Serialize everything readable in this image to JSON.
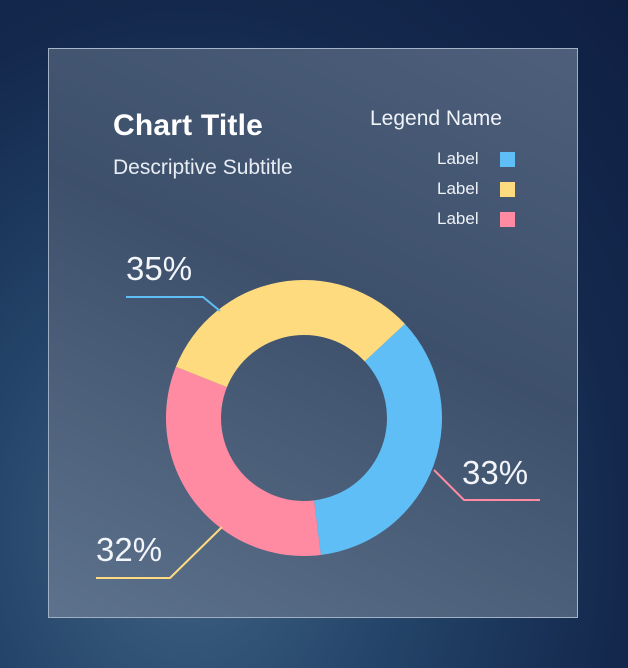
{
  "chart_data": {
    "type": "pie",
    "title": "Chart Title",
    "subtitle": "Descriptive Subtitle",
    "legend_title": "Legend Name",
    "legend_position": "top-right",
    "donut": true,
    "categories": [
      "Label",
      "Label",
      "Label"
    ],
    "values": [
      35,
      33,
      32
    ],
    "value_labels": [
      "35%",
      "33%",
      "32%"
    ],
    "colors": [
      "#5fbef5",
      "#ff8ba3",
      "#ffdb80"
    ],
    "grid": false
  }
}
